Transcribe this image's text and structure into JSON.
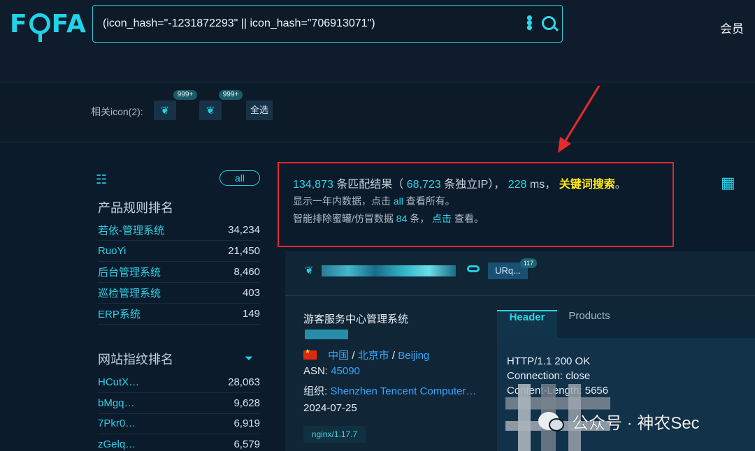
{
  "logo": "FOFA",
  "search": {
    "value": "(icon_hash=\"-1231872293\" || icon_hash=\"706913071\")"
  },
  "header": {
    "member": "会员"
  },
  "icons": {
    "label": "相关icon(2):",
    "badges": [
      "999+",
      "999+"
    ],
    "select_all": "全选"
  },
  "sidebar": {
    "all": "all",
    "product_title": "产品规则排名",
    "products": [
      {
        "name": "若依-管理系统",
        "count": "34,234"
      },
      {
        "name": "RuoYi",
        "count": "21,450"
      },
      {
        "name": "后台管理系统",
        "count": "8,460"
      },
      {
        "name": "巡检管理系统",
        "count": "403"
      },
      {
        "name": "ERP系统",
        "count": "149"
      }
    ],
    "site_title": "网站指纹排名",
    "sites": [
      {
        "name": "HCutX…",
        "count": "28,063"
      },
      {
        "name": "bMgq…",
        "count": "9,628"
      },
      {
        "name": "7Pkr0…",
        "count": "6,919"
      },
      {
        "name": "zGelq…",
        "count": "6,579"
      }
    ]
  },
  "results": {
    "total": "134,873",
    "total_label": "条匹配结果（",
    "unique_ip": "68,723",
    "unique_label": "条独立IP），",
    "time": "228",
    "time_unit": "ms，",
    "keyword_search": "关键词搜索",
    "keyword_suffix": "。",
    "line2_prefix": "显示一年内数据，点击",
    "line2_link": "all",
    "line2_suffix": "查看所有。",
    "line3_prefix": "智能排除蜜罐/仿冒数据",
    "honeypot": "84",
    "line3_middle": "条，",
    "line3_link": "点击",
    "line3_suffix": "查看。"
  },
  "card": {
    "tag": "URq...",
    "tag_badge": "117",
    "title": "游客服务中心管理系统",
    "country": "中国",
    "city": "北京市",
    "city_en": "Beijing",
    "asn_label": "ASN:",
    "asn": "45090",
    "org_label": "组织:",
    "org": "Shenzhen Tencent Computer…",
    "date": "2024-07-25",
    "server": "nginx/1.17.7"
  },
  "panel": {
    "tabs": [
      "Header",
      "Products"
    ],
    "http": "HTTP/1.1 200 OK\nConnection: close\nContent-Length: 5656"
  },
  "watermark": "公众号 · 神农Sec"
}
